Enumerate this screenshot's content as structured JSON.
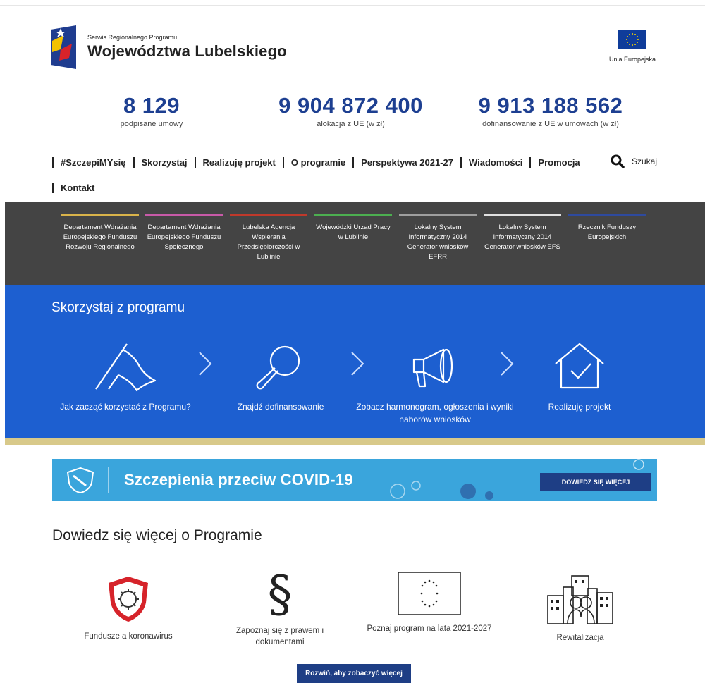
{
  "header": {
    "logo_small": "Serwis Regionalnego Programu",
    "logo_big": "Województwa Lubelskiego",
    "eu_label": "Unia Europejska"
  },
  "stats": [
    {
      "value": "8 129",
      "label": "podpisane umowy"
    },
    {
      "value": "9 904 872 400",
      "label": "alokacja z UE (w zł)"
    },
    {
      "value": "9 913 188 562",
      "label": "dofinansowanie z UE w umowach (w zł)"
    }
  ],
  "nav": {
    "items": [
      "#SzczepiMYsię",
      "Skorzystaj",
      "Realizuję projekt",
      "O programie",
      "Perspektywa 2021-27",
      "Wiadomości",
      "Promocja",
      "Kontakt"
    ],
    "search_label": "Szukaj"
  },
  "institutions": [
    {
      "label": "Departament Wdrażania Europejskiego Funduszu Rozwoju Regionalnego",
      "color": "#d9b34a"
    },
    {
      "label": "Departament Wdrażania Europejskiego Funduszu Społecznego",
      "color": "#c85aa8"
    },
    {
      "label": "Lubelska Agencja Wspierania Przedsiębiorczości w Lublinie",
      "color": "#c0392b"
    },
    {
      "label": "Wojewódzki Urząd Pracy w Lublinie",
      "color": "#4caf50"
    },
    {
      "label": "Lokalny System Informatyczny 2014 Generator wniosków EFRR",
      "color": "#9e9e9e"
    },
    {
      "label": "Lokalny System Informatyczny 2014 Generator wniosków EFS",
      "color": "#e0e0e0"
    },
    {
      "label": "Rzecznik Funduszy Europejskich",
      "color": "#2e4a9e"
    }
  ],
  "skorzystaj": {
    "title": "Skorzystaj z programu",
    "steps": [
      {
        "label": "Jak zacząć korzystać z Programu?",
        "icon": "flag-icon"
      },
      {
        "label": "Znajdź dofinansowanie",
        "icon": "magnifier-icon"
      },
      {
        "label": "Zobacz harmonogram, ogłoszenia i wyniki naborów wniosków",
        "icon": "megaphone-icon"
      },
      {
        "label": "Realizuję projekt",
        "icon": "house-check-icon"
      }
    ]
  },
  "covid": {
    "title": "Szczepienia przeciw COVID-19",
    "button": "DOWIEDZ SIĘ WIĘCEJ"
  },
  "dowiedz": {
    "title": "Dowiedz się więcej o Programie",
    "cards": [
      {
        "label": "Fundusze a koronawirus",
        "icon": "virus-shield-icon"
      },
      {
        "label": "Zapoznaj się z prawem i dokumentami",
        "icon": "paragraph-icon"
      },
      {
        "label": "Poznaj program na lata 2021-2027",
        "icon": "eu-flag-icon"
      },
      {
        "label": "Rewitalizacja",
        "icon": "city-people-icon"
      }
    ],
    "expand_button": "Rozwiń, aby zobaczyć więcej"
  }
}
